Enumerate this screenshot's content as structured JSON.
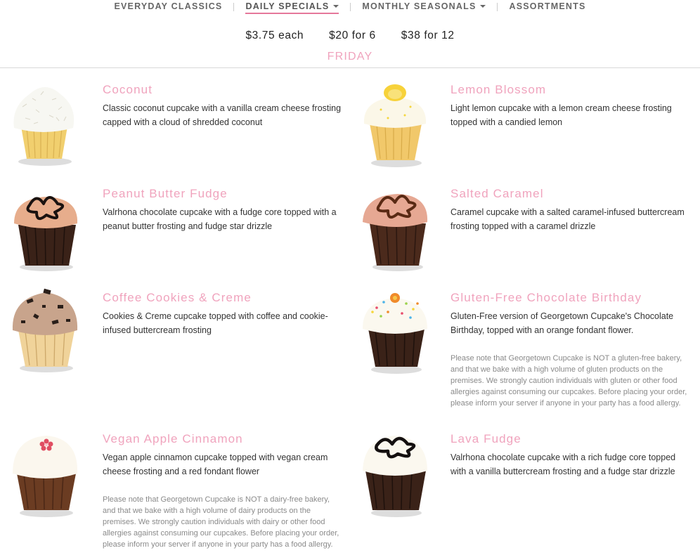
{
  "nav": {
    "items": [
      {
        "label": "EVERYDAY CLASSICS",
        "caret": false,
        "active": false
      },
      {
        "label": "DAILY SPECIALS",
        "caret": true,
        "active": true
      },
      {
        "label": "MONTHLY SEASONALS",
        "caret": true,
        "active": false
      },
      {
        "label": "ASSORTMENTS",
        "caret": false,
        "active": false
      }
    ]
  },
  "pricing": {
    "each": "$3.75 each",
    "six": "$20 for 6",
    "twelve": "$38 for 12"
  },
  "day": "FRIDAY",
  "items": [
    {
      "name": "Coconut",
      "desc": "Classic coconut cupcake with a vanilla cream cheese frosting capped with a cloud of shredded coconut"
    },
    {
      "name": "Lemon Blossom",
      "desc": "Light lemon cupcake with a lemon cream cheese frosting topped with a candied lemon"
    },
    {
      "name": "Peanut Butter Fudge",
      "desc": "Valrhona chocolate cupcake with a fudge core topped with a peanut butter frosting and fudge star drizzle"
    },
    {
      "name": "Salted Caramel",
      "desc": "Caramel cupcake with a salted caramel-infused buttercream frosting topped with a caramel drizzle"
    },
    {
      "name": "Coffee Cookies & Creme",
      "desc": "Cookies & Creme cupcake topped with coffee and cookie-infused buttercream frosting"
    },
    {
      "name": "Gluten-Free Chocolate Birthday",
      "desc": "Gluten-Free version of Georgetown Cupcake's Chocolate Birthday, topped with an orange fondant flower.",
      "note": "Please note that Georgetown Cupcake is NOT a gluten-free bakery, and that we bake with a high volume of gluten products on the premises. We strongly caution individuals with gluten or other food allergies against consuming our cupcakes. Before placing your order, please inform your server if anyone in your party has a food allergy."
    },
    {
      "name": "Vegan Apple Cinnamon",
      "desc": "Vegan apple cinnamon cupcake topped with vegan cream cheese frosting and a red fondant flower",
      "note": "Please note that Georgetown Cupcake is NOT a dairy-free bakery, and that we bake with a high volume of dairy products on the premises. We strongly caution individuals with dairy or other food allergies against consuming our cupcakes. Before placing your order, please inform your server if anyone in your party has a food allergy."
    },
    {
      "name": "Lava Fudge",
      "desc": "Valrhona chocolate cupcake with a rich fudge core topped with a vanilla buttercream frosting and a fudge star drizzle"
    }
  ],
  "colors": {
    "accent_pink": "#f0a3bd",
    "underline_pink": "#e5789b",
    "nav_gray": "#666666",
    "note_gray": "#8a8a8a"
  }
}
